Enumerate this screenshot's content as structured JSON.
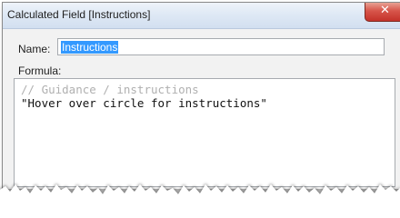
{
  "window": {
    "title": "Calculated Field [Instructions]"
  },
  "name_field": {
    "label": "Name:",
    "value": "Instructions"
  },
  "formula": {
    "label": "Formula:",
    "lines": [
      "// Guidance / instructions",
      "\"Hover over circle for instructions\""
    ]
  },
  "icons": {
    "close": "close-icon"
  },
  "colors": {
    "selection": "#3399ff",
    "close_button": "#d7554a",
    "comment": "#b0b0b0"
  }
}
